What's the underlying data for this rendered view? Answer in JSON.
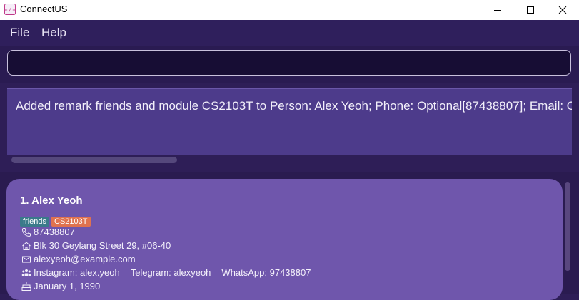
{
  "window": {
    "title": "ConnectUS"
  },
  "menu": {
    "file": "File",
    "help": "Help"
  },
  "command": {
    "value": ""
  },
  "result": {
    "message": "Added remark friends and module CS2103T to Person: Alex Yeoh; Phone: Optional[87438807]; Email: Optional[alexyeoh@example.com]"
  },
  "persons": [
    {
      "name": "1.  Alex Yeoh",
      "tags": {
        "remark": "friends",
        "module": "CS2103T"
      },
      "phone": "87438807",
      "address": "Blk 30 Geylang Street 29, #06-40",
      "email": "alexyeoh@example.com",
      "social": {
        "instagram": "Instagram: alex.yeoh",
        "telegram": "Telegram: alexyeoh",
        "whatsapp": "WhatsApp: 97438807"
      },
      "birthday": "January 1, 1990"
    }
  ],
  "icons": {
    "app": "app-code-icon",
    "minimize": "minimize-icon",
    "maximize": "maximize-icon",
    "close": "close-icon",
    "phone": "phone-icon",
    "address": "home-icon",
    "email": "mail-icon",
    "social": "people-icon",
    "birthday": "cake-icon"
  },
  "colors": {
    "background": "#2e1e57",
    "card": "#6f56ac",
    "result_box": "#4d3b8b",
    "tag_remark": "#3a7a8a",
    "tag_module": "#e0724f"
  }
}
